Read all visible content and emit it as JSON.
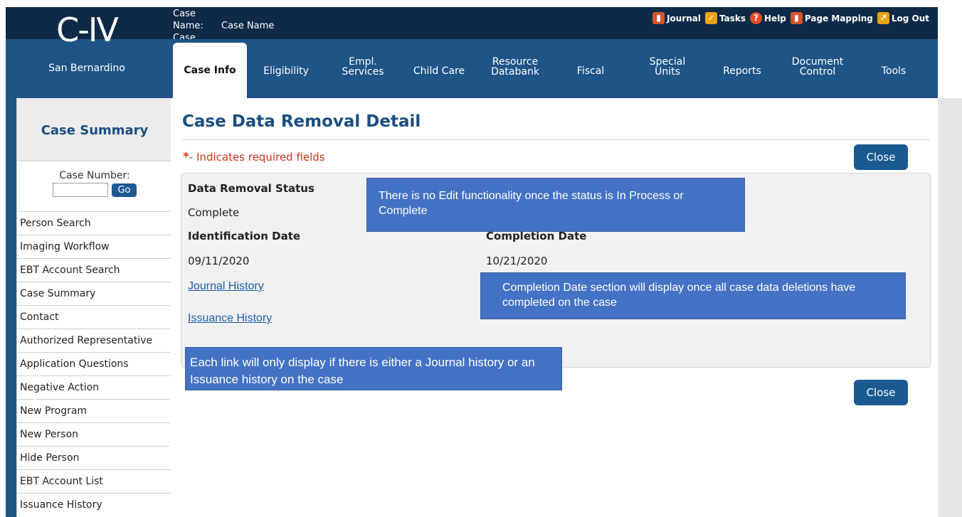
{
  "header": {
    "case_name_label": "Case Name:",
    "case_name_value": "Case Name",
    "case_number_label": "Case Number:",
    "links": [
      {
        "label": "Journal",
        "icon": "journal-icon"
      },
      {
        "label": "Tasks",
        "icon": "tasks-icon"
      },
      {
        "label": "Help",
        "icon": "help-icon"
      },
      {
        "label": "Page Mapping",
        "icon": "page-mapping-icon"
      },
      {
        "label": "Log Out",
        "icon": "logout-icon"
      }
    ]
  },
  "logo": {
    "mark": "C-IV",
    "county": "San Bernardino"
  },
  "nav": {
    "tabs": [
      {
        "label": "Case Info",
        "active": true
      },
      {
        "label": "Eligibility"
      },
      {
        "label": "Empl.\nServices"
      },
      {
        "label": "Child Care"
      },
      {
        "label": "Resource\nDatabank"
      },
      {
        "label": "Fiscal"
      },
      {
        "label": "Special\nUnits"
      },
      {
        "label": "Reports"
      },
      {
        "label": "Document\nControl"
      },
      {
        "label": "Tools"
      }
    ]
  },
  "sidebar": {
    "title": "Case Summary",
    "case_number_label": "Case Number:",
    "go_label": "Go",
    "items": [
      "Person Search",
      "Imaging Workflow",
      "EBT Account Search",
      "Case Summary",
      "Contact",
      "Authorized Representative",
      "Application Questions",
      "Negative Action",
      "New Program",
      "New Person",
      "Hide Person",
      "EBT Account List",
      "Issuance History"
    ]
  },
  "main": {
    "page_title": "Case Data Removal Detail",
    "required_star": "*",
    "required_text": "- Indicates required fields",
    "close_label": "Close",
    "data_removal_status_label": "Data Removal Status",
    "data_removal_status_value": "Complete",
    "identification_date_label": "Identification Date",
    "identification_date_value": "09/11/2020",
    "completion_date_label": "Completion Date",
    "completion_date_value": "10/21/2020",
    "journal_history_link": "Journal History",
    "issuance_history_link": "Issuance History"
  },
  "callouts": {
    "edit_note": "There is no Edit functionality once the status is In Process or Complete",
    "completion_note": "Completion Date section will display once all case data deletions have completed on the case",
    "links_note": "Each link will only display if there is either a Journal history or an Issuance history on the case"
  },
  "colors": {
    "header_dark": "#0e2a47",
    "nav_blue": "#1f5486",
    "title_blue": "#1a4d80",
    "button_blue": "#1a5a90",
    "callout_blue": "#4472c4",
    "required_red": "#c8361f"
  }
}
